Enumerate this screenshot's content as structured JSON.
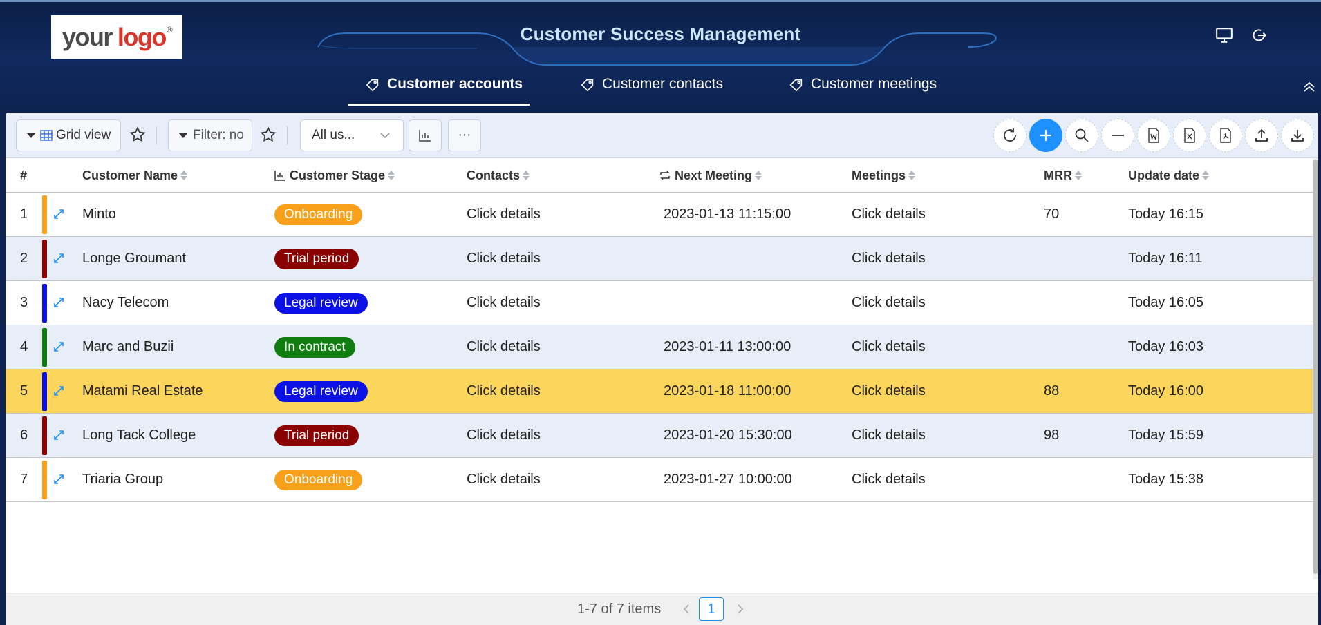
{
  "header": {
    "logo_your": "your",
    "logo_logo": "logo",
    "logo_reg": "®",
    "title": "Customer Success Management"
  },
  "tabs": [
    {
      "label": "Customer accounts",
      "active": true
    },
    {
      "label": "Customer contacts",
      "active": false
    },
    {
      "label": "Customer meetings",
      "active": false
    }
  ],
  "toolbar": {
    "grid_view_label": "Grid view",
    "filter_label": "Filter: no",
    "user_select_value": "All us...",
    "more_label": "···"
  },
  "table": {
    "columns": [
      "#",
      "Customer Name",
      "Customer Stage",
      "Contacts",
      "Next Meeting",
      "Meetings",
      "MRR",
      "Update date"
    ],
    "rows": [
      {
        "num": "1",
        "name": "Minto",
        "stage": "Onboarding",
        "stage_color": "#f9a01b",
        "contacts": "Click details",
        "next_meeting": "2023-01-13 11:15:00",
        "meetings": "Click details",
        "mrr": "70",
        "update": "Today 16:15",
        "selected": false
      },
      {
        "num": "2",
        "name": "Longe Groumant",
        "stage": "Trial period",
        "stage_color": "#8b0000",
        "contacts": "Click details",
        "next_meeting": "",
        "meetings": "Click details",
        "mrr": "",
        "update": "Today 16:11",
        "selected": false
      },
      {
        "num": "3",
        "name": "Nacy Telecom",
        "stage": "Legal review",
        "stage_color": "#0a10e6",
        "contacts": "Click details",
        "next_meeting": "",
        "meetings": "Click details",
        "mrr": "",
        "update": "Today 16:05",
        "selected": false
      },
      {
        "num": "4",
        "name": "Marc and Buzii",
        "stage": "In contract",
        "stage_color": "#0f7d0f",
        "contacts": "Click details",
        "next_meeting": "2023-01-11 13:00:00",
        "meetings": "Click details",
        "mrr": "",
        "update": "Today 16:03",
        "selected": false
      },
      {
        "num": "5",
        "name": "Matami Real Estate",
        "stage": "Legal review",
        "stage_color": "#0a10e6",
        "contacts": "Click details",
        "next_meeting": "2023-01-18 11:00:00",
        "meetings": "Click details",
        "mrr": "88",
        "update": "Today 16:00",
        "selected": true
      },
      {
        "num": "6",
        "name": "Long Tack College",
        "stage": "Trial period",
        "stage_color": "#8b0000",
        "contacts": "Click details",
        "next_meeting": "2023-01-20 15:30:00",
        "meetings": "Click details",
        "mrr": "98",
        "update": "Today 15:59",
        "selected": false
      },
      {
        "num": "7",
        "name": "Triaria Group",
        "stage": "Onboarding",
        "stage_color": "#f9a01b",
        "contacts": "Click details",
        "next_meeting": "2023-01-27 10:00:00",
        "meetings": "Click details",
        "mrr": "",
        "update": "Today 15:38",
        "selected": false
      }
    ]
  },
  "pagination": {
    "summary": "1-7 of 7 items",
    "current_page": "1"
  },
  "colors": {
    "accent": "#1e90ff",
    "selected_row": "#fcd65c",
    "header_bg": "#0e2350"
  }
}
